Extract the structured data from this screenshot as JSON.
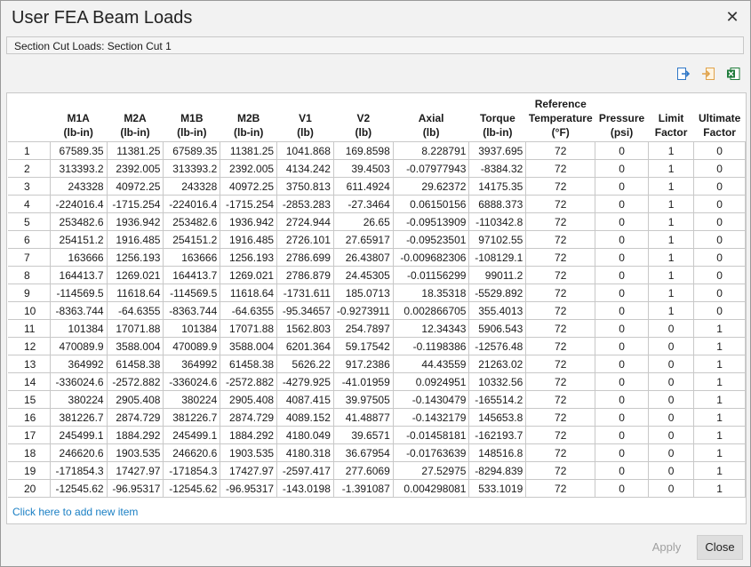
{
  "window": {
    "title": "User FEA Beam Loads"
  },
  "section_bar": {
    "label": "Section Cut Loads: Section Cut 1"
  },
  "toolbar": {
    "icons": [
      "export-icon",
      "import-icon",
      "excel-icon"
    ]
  },
  "table": {
    "headers": [
      "",
      "M1A\n(lb-in)",
      "M2A\n(lb-in)",
      "M1B\n(lb-in)",
      "M2B\n(lb-in)",
      "V1\n(lb)",
      "V2\n(lb)",
      "Axial\n(lb)",
      "Torque\n(lb-in)",
      "Reference\nTemperature\n(°F)",
      "Pressure\n(psi)",
      "Limit\nFactor",
      "Ultimate\nFactor"
    ],
    "rows": [
      [
        "1",
        "67589.35",
        "11381.25",
        "67589.35",
        "11381.25",
        "1041.868",
        "169.8598",
        "8.228791",
        "3937.695",
        "72",
        "0",
        "1",
        "0"
      ],
      [
        "2",
        "313393.2",
        "2392.005",
        "313393.2",
        "2392.005",
        "4134.242",
        "39.4503",
        "-0.07977943",
        "-8384.32",
        "72",
        "0",
        "1",
        "0"
      ],
      [
        "3",
        "243328",
        "40972.25",
        "243328",
        "40972.25",
        "3750.813",
        "611.4924",
        "29.62372",
        "14175.35",
        "72",
        "0",
        "1",
        "0"
      ],
      [
        "4",
        "-224016.4",
        "-1715.254",
        "-224016.4",
        "-1715.254",
        "-2853.283",
        "-27.3464",
        "0.06150156",
        "6888.373",
        "72",
        "0",
        "1",
        "0"
      ],
      [
        "5",
        "253482.6",
        "1936.942",
        "253482.6",
        "1936.942",
        "2724.944",
        "26.65",
        "-0.09513909",
        "-110342.8",
        "72",
        "0",
        "1",
        "0"
      ],
      [
        "6",
        "254151.2",
        "1916.485",
        "254151.2",
        "1916.485",
        "2726.101",
        "27.65917",
        "-0.09523501",
        "97102.55",
        "72",
        "0",
        "1",
        "0"
      ],
      [
        "7",
        "163666",
        "1256.193",
        "163666",
        "1256.193",
        "2786.699",
        "26.43807",
        "-0.009682306",
        "-108129.1",
        "72",
        "0",
        "1",
        "0"
      ],
      [
        "8",
        "164413.7",
        "1269.021",
        "164413.7",
        "1269.021",
        "2786.879",
        "24.45305",
        "-0.01156299",
        "99011.2",
        "72",
        "0",
        "1",
        "0"
      ],
      [
        "9",
        "-114569.5",
        "11618.64",
        "-114569.5",
        "11618.64",
        "-1731.611",
        "185.0713",
        "18.35318",
        "-5529.892",
        "72",
        "0",
        "1",
        "0"
      ],
      [
        "10",
        "-8363.744",
        "-64.6355",
        "-8363.744",
        "-64.6355",
        "-95.34657",
        "-0.9273911",
        "0.002866705",
        "355.4013",
        "72",
        "0",
        "1",
        "0"
      ],
      [
        "11",
        "101384",
        "17071.88",
        "101384",
        "17071.88",
        "1562.803",
        "254.7897",
        "12.34343",
        "5906.543",
        "72",
        "0",
        "0",
        "1"
      ],
      [
        "12",
        "470089.9",
        "3588.004",
        "470089.9",
        "3588.004",
        "6201.364",
        "59.17542",
        "-0.1198386",
        "-12576.48",
        "72",
        "0",
        "0",
        "1"
      ],
      [
        "13",
        "364992",
        "61458.38",
        "364992",
        "61458.38",
        "5626.22",
        "917.2386",
        "44.43559",
        "21263.02",
        "72",
        "0",
        "0",
        "1"
      ],
      [
        "14",
        "-336024.6",
        "-2572.882",
        "-336024.6",
        "-2572.882",
        "-4279.925",
        "-41.01959",
        "0.0924951",
        "10332.56",
        "72",
        "0",
        "0",
        "1"
      ],
      [
        "15",
        "380224",
        "2905.408",
        "380224",
        "2905.408",
        "4087.415",
        "39.97505",
        "-0.1430479",
        "-165514.2",
        "72",
        "0",
        "0",
        "1"
      ],
      [
        "16",
        "381226.7",
        "2874.729",
        "381226.7",
        "2874.729",
        "4089.152",
        "41.48877",
        "-0.1432179",
        "145653.8",
        "72",
        "0",
        "0",
        "1"
      ],
      [
        "17",
        "245499.1",
        "1884.292",
        "245499.1",
        "1884.292",
        "4180.049",
        "39.6571",
        "-0.01458181",
        "-162193.7",
        "72",
        "0",
        "0",
        "1"
      ],
      [
        "18",
        "246620.6",
        "1903.535",
        "246620.6",
        "1903.535",
        "4180.318",
        "36.67954",
        "-0.01763639",
        "148516.8",
        "72",
        "0",
        "0",
        "1"
      ],
      [
        "19",
        "-171854.3",
        "17427.97",
        "-171854.3",
        "17427.97",
        "-2597.417",
        "277.6069",
        "27.52975",
        "-8294.839",
        "72",
        "0",
        "0",
        "1"
      ],
      [
        "20",
        "-12545.62",
        "-96.95317",
        "-12545.62",
        "-96.95317",
        "-143.0198",
        "-1.391087",
        "0.004298081",
        "533.1019",
        "72",
        "0",
        "0",
        "1"
      ]
    ]
  },
  "add_item": {
    "label": "Click here to add new item"
  },
  "buttons": {
    "apply": "Apply",
    "close": "Close"
  },
  "colors": {
    "link": "#1a7fc4",
    "disabled": "#a0a0a0",
    "excel_green": "#1e7b3a",
    "icon_blue": "#2f77c7",
    "icon_orange": "#e0a24a"
  }
}
